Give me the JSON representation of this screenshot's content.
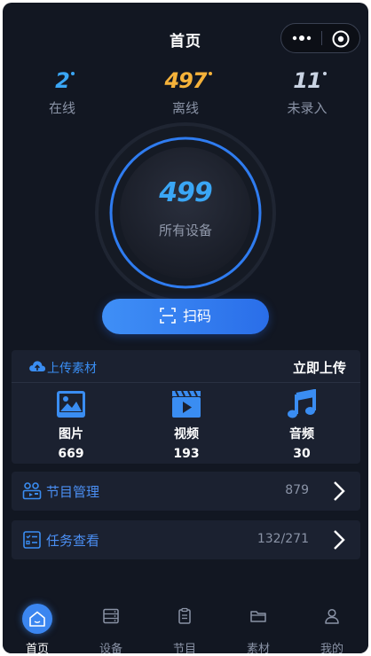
{
  "header": {
    "title": "首页"
  },
  "stats": [
    {
      "value": "2",
      "label": "在线",
      "color": "#3aa6f5"
    },
    {
      "value": "497",
      "label": "离线",
      "color": "#f5b23a"
    },
    {
      "value": "11",
      "label": "未录入",
      "color": "#c9d3e3"
    }
  ],
  "total": {
    "value": "499",
    "label": "所有设备"
  },
  "scan": {
    "label": "扫码"
  },
  "upload": {
    "title": "上传素材",
    "action": "立即上传",
    "items": [
      {
        "label": "图片",
        "count": "669"
      },
      {
        "label": "视频",
        "count": "193"
      },
      {
        "label": "音频",
        "count": "30"
      }
    ]
  },
  "rows": [
    {
      "label": "节目管理",
      "value": "879"
    },
    {
      "label": "任务查看",
      "value": "132/271"
    }
  ],
  "tabs": [
    {
      "label": "首页",
      "active": true
    },
    {
      "label": "设备",
      "active": false
    },
    {
      "label": "节目",
      "active": false
    },
    {
      "label": "素材",
      "active": false
    },
    {
      "label": "我的",
      "active": false
    }
  ],
  "colors": {
    "accent": "#3b86f0",
    "background": "#121722",
    "card": "#1b2130"
  }
}
